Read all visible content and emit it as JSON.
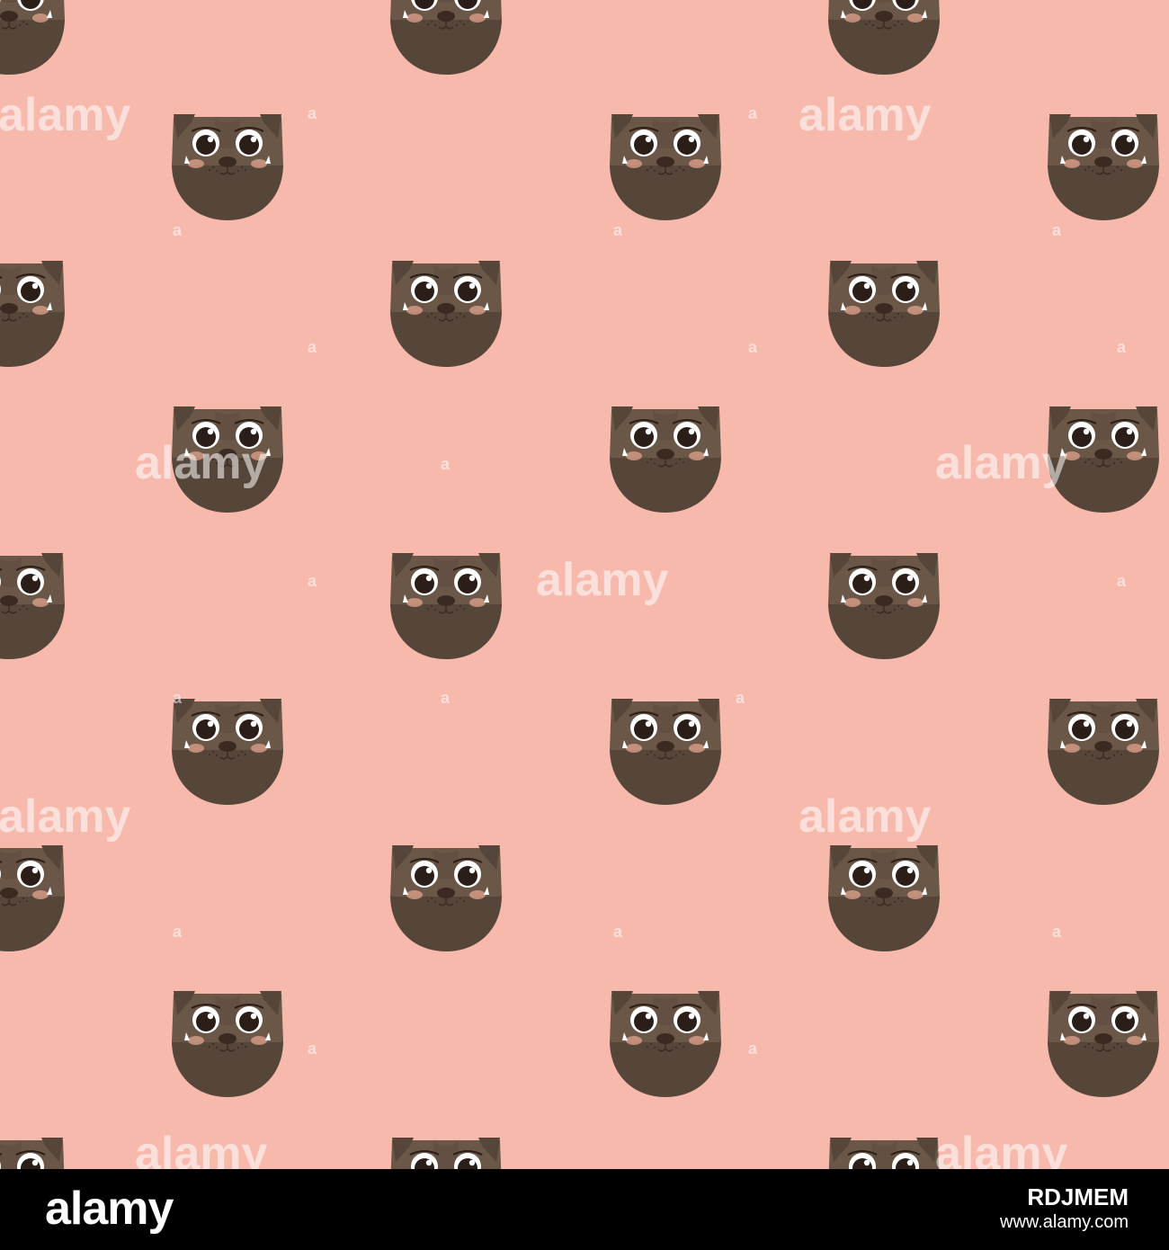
{
  "pattern": {
    "background_color": "#f8b9ad",
    "motif": "pug-face-icon",
    "head_color": "#6a5747",
    "jaw_color": "#56463a",
    "cheek_color": "#e9a892",
    "eye_white": "#ffffff",
    "pupil_color": "#2b1e18"
  },
  "watermark": {
    "text": "alamy",
    "letter": "a",
    "color": "#ffffff"
  },
  "footer": {
    "logo_text": "alamy",
    "image_id": "RDJMEM",
    "site": "www.alamy.com"
  }
}
